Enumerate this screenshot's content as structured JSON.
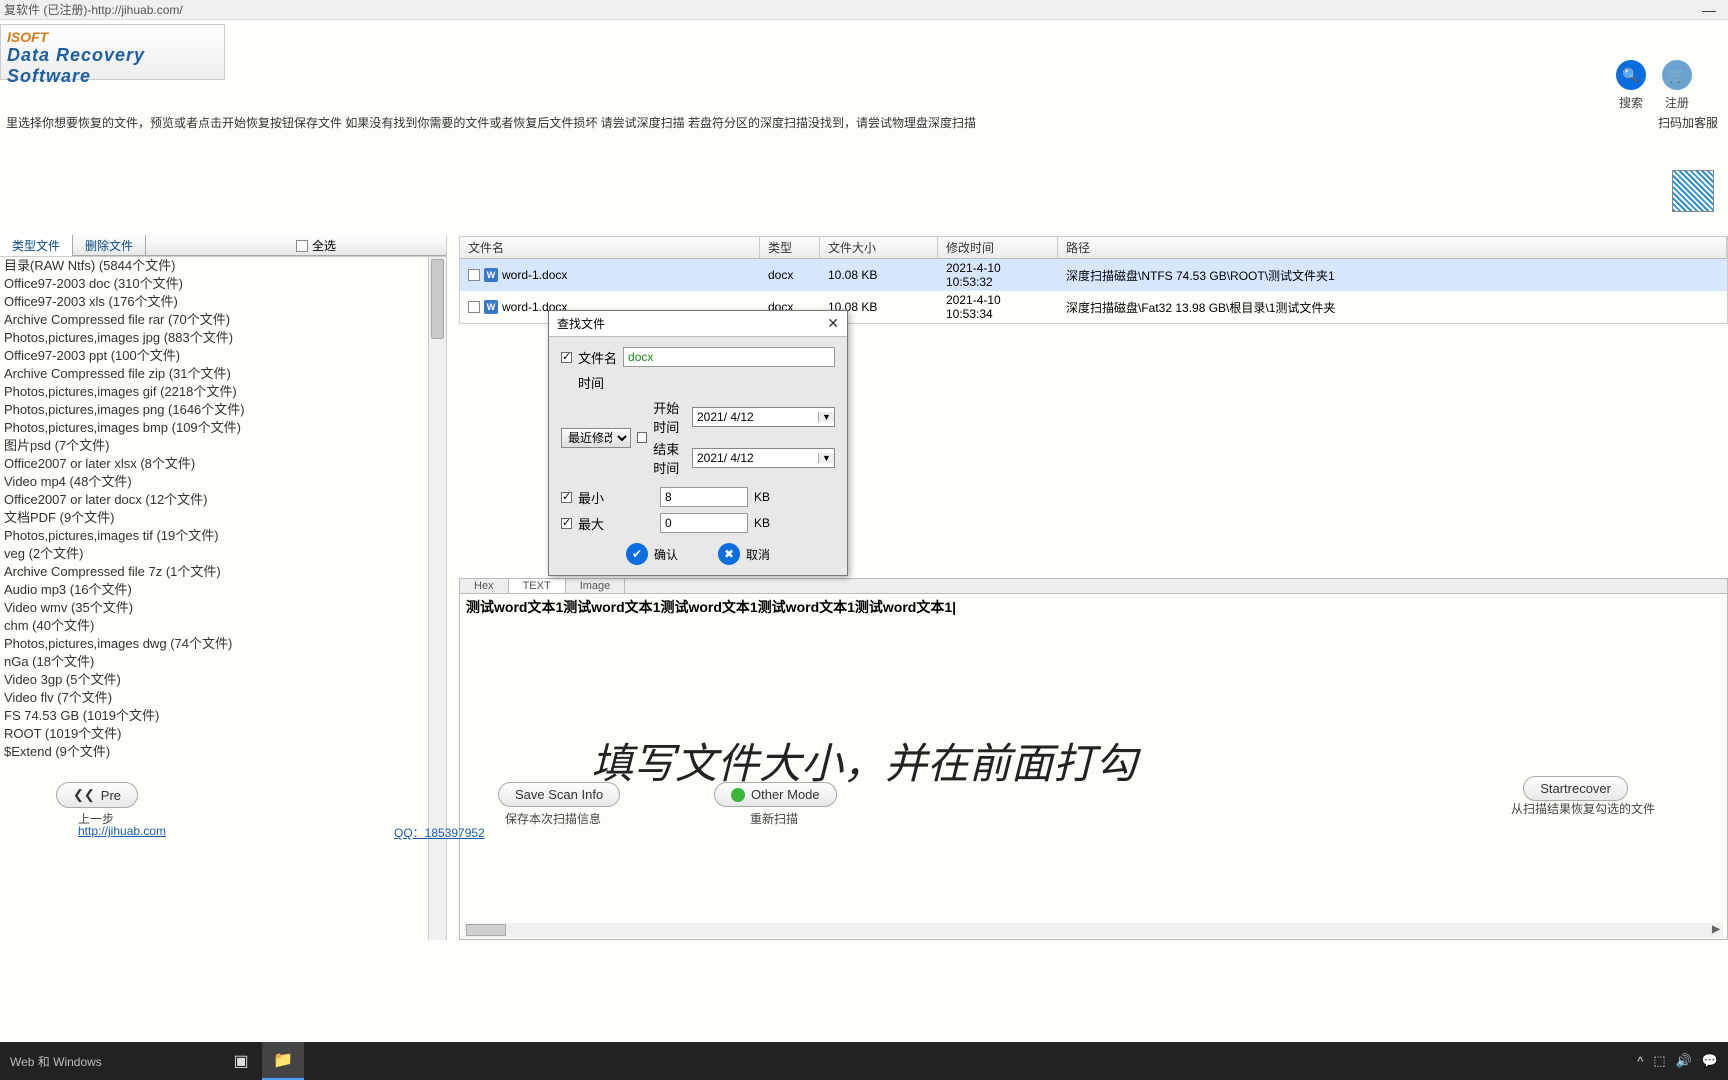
{
  "title_bar": "复软件 (已注册)-http://jihuab.com/",
  "logo": {
    "brand": "ISOFT",
    "tagline": "Data Recovery Software"
  },
  "header_btns": {
    "search": "搜索",
    "register": "注册"
  },
  "instruction": "里选择你想要恢复的文件，预览或者点击开始恢复按钮保存文件 如果没有找到你需要的文件或者恢复后文件损坏 请尝试深度扫描 若盘符分区的深度扫描没找到，请尝试物理盘深度扫描",
  "instruction_right": "扫码加客服",
  "left_tabs": {
    "tab1": "类型文件",
    "tab2": "删除文件",
    "select_all": "全选"
  },
  "tree_items": [
    "目录(RAW Ntfs) (5844个文件)",
    "Office97-2003 doc (310个文件)",
    "Office97-2003 xls (176个文件)",
    "Archive Compressed file rar (70个文件)",
    "Photos,pictures,images jpg (883个文件)",
    "Office97-2003 ppt (100个文件)",
    "Archive Compressed file zip (31个文件)",
    "Photos,pictures,images gif (2218个文件)",
    "Photos,pictures,images png (1646个文件)",
    "Photos,pictures,images bmp (109个文件)",
    "图片psd (7个文件)",
    "Office2007 or later xlsx (8个文件)",
    "Video mp4 (48个文件)",
    "Office2007 or later docx (12个文件)",
    "文档PDF (9个文件)",
    "Photos,pictures,images tif (19个文件)",
    "veg (2个文件)",
    "Archive Compressed file 7z (1个文件)",
    "Audio mp3 (16个文件)",
    "Video wmv (35个文件)",
    "chm (40个文件)",
    "Photos,pictures,images dwg (74个文件)",
    "nGa (18个文件)",
    "Video 3gp (5个文件)",
    "Video flv (7个文件)",
    "FS 74.53 GB (1019个文件)",
    "ROOT (1019个文件)",
    "  $Extend (9个文件)"
  ],
  "table": {
    "headers": {
      "name": "文件名",
      "type": "类型",
      "size": "文件大小",
      "mtime": "修改时间",
      "path": "路径"
    },
    "rows": [
      {
        "name": "word-1.docx",
        "type": "docx",
        "size": "10.08 KB",
        "mtime": "2021-4-10 10:53:32",
        "path": "深度扫描磁盘\\NTFS 74.53 GB\\ROOT\\测试文件夹1"
      },
      {
        "name": "word-1.docx",
        "type": "docx",
        "size": "10.08 KB",
        "mtime": "2021-4-10 10:53:34",
        "path": "深度扫描磁盘\\Fat32 13.98 GB\\根目录\\1测试文件夹"
      }
    ]
  },
  "preview_tabs": {
    "hex": "Hex",
    "text": "TEXT",
    "image": "Image"
  },
  "preview_text": "测试word文本1测试word文本1测试word文本1测试word文本1测试word文本1|",
  "dialog": {
    "title": "查找文件",
    "filename_label": "文件名",
    "filename_value": "docx",
    "time_label": "时间",
    "time_mode": "最近修改时",
    "start_time_label": "开始时间",
    "end_time_label": "结束时间",
    "start_date": "2021/ 4/12",
    "end_date": "2021/ 4/12",
    "min_label": "最小",
    "max_label": "最大",
    "min_value": "8",
    "max_value": "0",
    "unit": "KB",
    "ok": "确认",
    "cancel": "取消"
  },
  "big_caption": "填写文件大小，并在前面打勾",
  "bottom": {
    "prev": "Pre",
    "prev_arrows": "❮❮",
    "prev_sub": "上一步",
    "save": "Save Scan Info",
    "save_sub": "保存本次扫描信息",
    "other": "Other Mode",
    "other_sub": "重新扫描",
    "start": "Startrecover",
    "start_sub": "从扫描结果恢复勾选的文件",
    "link1": "http://jihuab.com",
    "qq": "QQ：185397952"
  },
  "taskbar": {
    "search_placeholder": "Web 和 Windows",
    "tray": {
      "up": "^",
      "net": "⬚",
      "vol": "🔊",
      "msg": "💬"
    }
  }
}
